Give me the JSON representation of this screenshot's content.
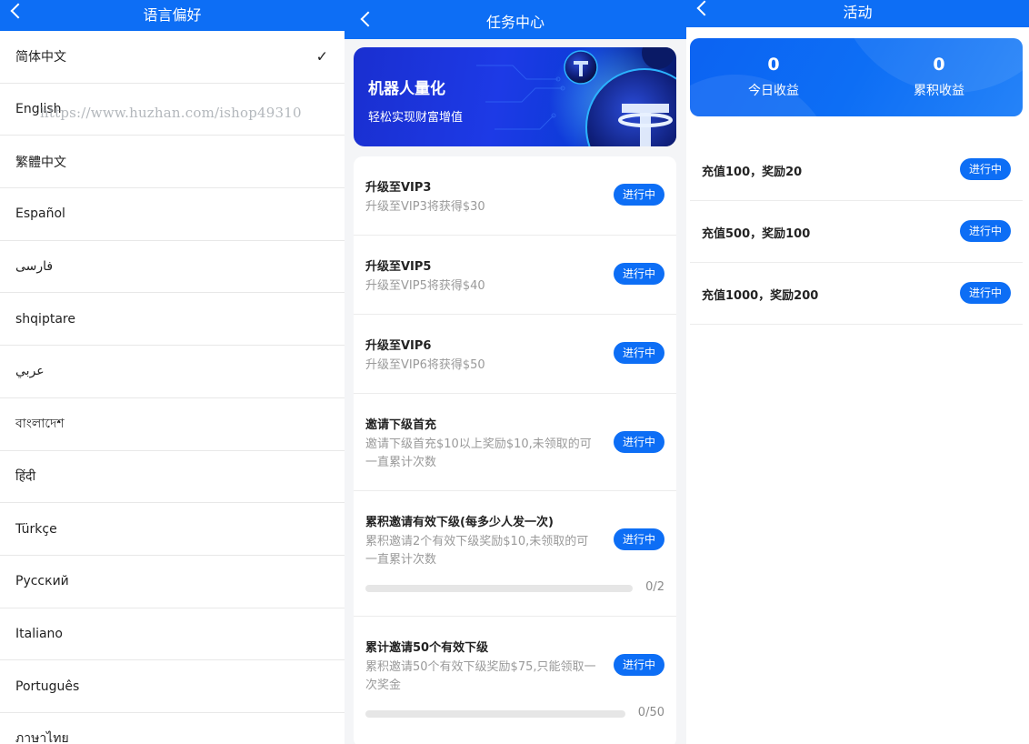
{
  "language_panel": {
    "title": "语言偏好",
    "watermark": "https://www.huzhan.com/ishop49310",
    "languages": [
      {
        "label": "简体中文",
        "selected": true
      },
      {
        "label": "English",
        "selected": false
      },
      {
        "label": "繁體中文",
        "selected": false
      },
      {
        "label": "Español",
        "selected": false
      },
      {
        "label": "فارسی",
        "selected": false
      },
      {
        "label": "shqiptare",
        "selected": false
      },
      {
        "label": "عربي",
        "selected": false
      },
      {
        "label": "বাংলাদেশ",
        "selected": false
      },
      {
        "label": "हिंदी",
        "selected": false
      },
      {
        "label": "Türkçe",
        "selected": false
      },
      {
        "label": "Русский",
        "selected": false
      },
      {
        "label": "Italiano",
        "selected": false
      },
      {
        "label": "Português",
        "selected": false
      },
      {
        "label": "ภาษาไทย",
        "selected": false
      }
    ],
    "check_mark": "✓"
  },
  "task_panel": {
    "title": "任务中心",
    "banner": {
      "title": "机器人量化",
      "subtitle": "轻松实现财富增值"
    },
    "tasks": [
      {
        "title": "升级至VIP3",
        "desc": "升级至VIP3将获得$30",
        "status": "进行中"
      },
      {
        "title": "升级至VIP5",
        "desc": "升级至VIP5将获得$40",
        "status": "进行中"
      },
      {
        "title": "升级至VIP6",
        "desc": "升级至VIP6将获得$50",
        "status": "进行中"
      },
      {
        "title": "邀请下级首充",
        "desc": "邀请下级首充$10以上奖励$10,未领取的可一直累计次数",
        "status": "进行中"
      },
      {
        "title": "累积邀请有效下级(每多少人发一次)",
        "desc": "累积邀请2个有效下级奖励$10,未领取的可一直累计次数",
        "status": "进行中",
        "progress": {
          "current": 0,
          "total": 2,
          "text": "0/2"
        }
      },
      {
        "title": "累计邀请50个有效下级",
        "desc": "累积邀请50个有效下级奖励$75,只能领取一次奖金",
        "status": "进行中",
        "progress": {
          "current": 0,
          "total": 50,
          "text": "0/50"
        }
      }
    ]
  },
  "activity_panel": {
    "title": "活动",
    "today_earnings": {
      "value": "0",
      "label": "今日收益"
    },
    "total_earnings": {
      "value": "0",
      "label": "累积收益"
    },
    "activities": [
      {
        "title": "充值100，奖励20",
        "status": "进行中"
      },
      {
        "title": "充值500，奖励100",
        "status": "进行中"
      },
      {
        "title": "充值1000，奖励200",
        "status": "进行中"
      }
    ]
  },
  "colors": {
    "primary": "#0d6ef5",
    "muted_text": "#9a9a9a"
  }
}
